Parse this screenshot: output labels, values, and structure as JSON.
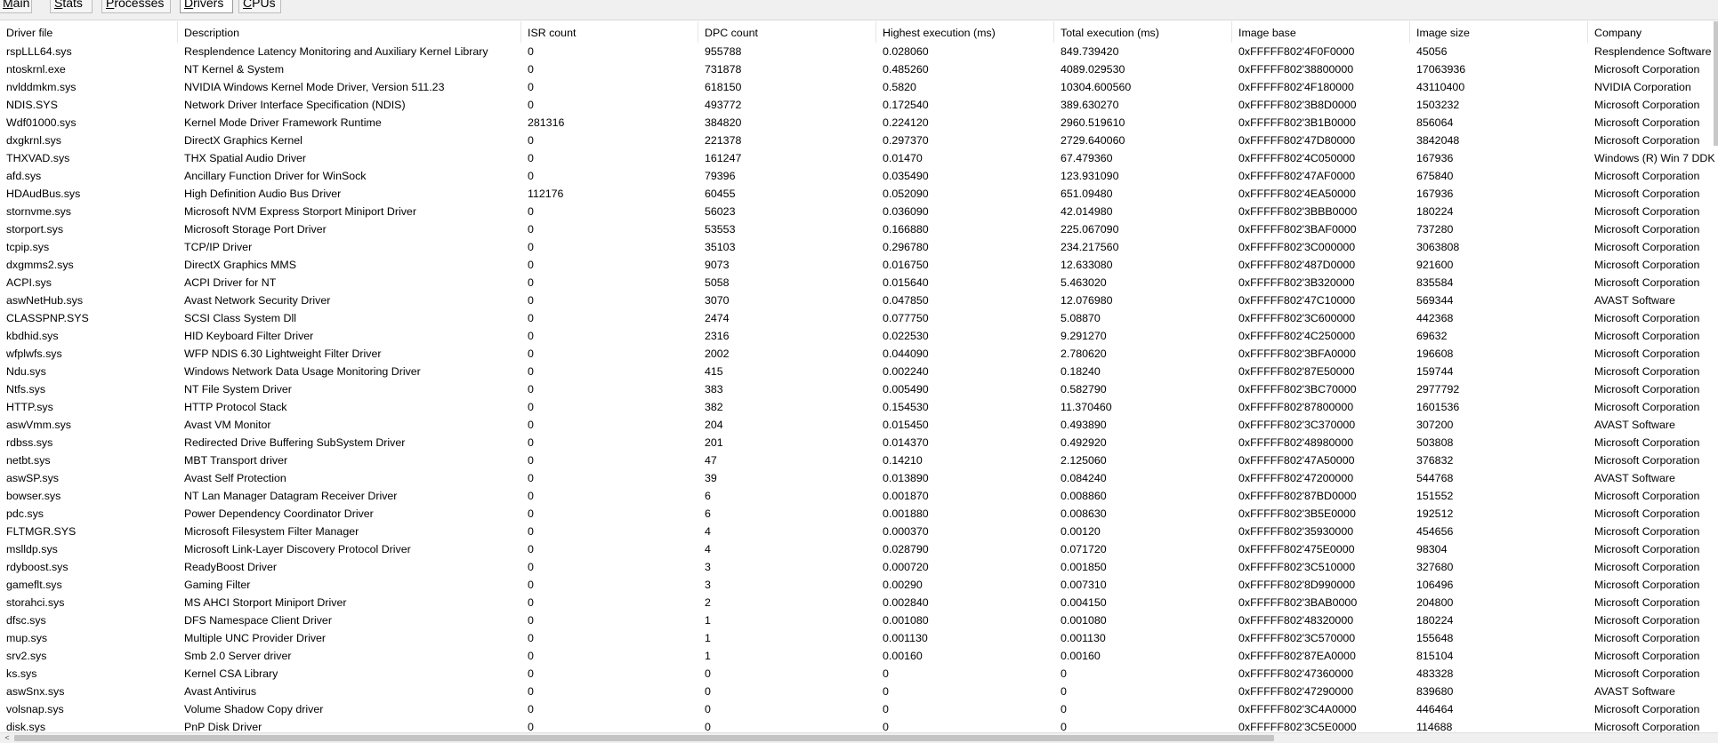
{
  "tabs": [
    {
      "label": "Main"
    },
    {
      "label": "Stats"
    },
    {
      "label": "Processes"
    },
    {
      "label": "Drivers"
    },
    {
      "label": "CPUs"
    }
  ],
  "columns": [
    "Driver file",
    "Description",
    "ISR count",
    "DPC count",
    "Highest execution (ms)",
    "Total execution (ms)",
    "Image base",
    "Image size",
    "Company"
  ],
  "rows": [
    [
      "rspLLL64.sys",
      "Resplendence Latency Monitoring and Auxiliary Kernel Library",
      "0",
      "955788",
      "0.028060",
      "849.739420",
      "0xFFFFF802'4F0F0000",
      "45056",
      "Resplendence Software"
    ],
    [
      "ntoskrnl.exe",
      "NT Kernel & System",
      "0",
      "731878",
      "0.485260",
      "4089.029530",
      "0xFFFFF802'38800000",
      "17063936",
      "Microsoft Corporation"
    ],
    [
      "nvlddmkm.sys",
      "NVIDIA Windows Kernel Mode Driver, Version 511.23",
      "0",
      "618150",
      "0.5820",
      "10304.600560",
      "0xFFFFF802'4F180000",
      "43110400",
      "NVIDIA Corporation"
    ],
    [
      "NDIS.SYS",
      "Network Driver Interface Specification (NDIS)",
      "0",
      "493772",
      "0.172540",
      "389.630270",
      "0xFFFFF802'3B8D0000",
      "1503232",
      "Microsoft Corporation"
    ],
    [
      "Wdf01000.sys",
      "Kernel Mode Driver Framework Runtime",
      "281316",
      "384820",
      "0.224120",
      "2960.519610",
      "0xFFFFF802'3B1B0000",
      "856064",
      "Microsoft Corporation"
    ],
    [
      "dxgkrnl.sys",
      "DirectX Graphics Kernel",
      "0",
      "221378",
      "0.297370",
      "2729.640060",
      "0xFFFFF802'47D80000",
      "3842048",
      "Microsoft Corporation"
    ],
    [
      "THXVAD.sys",
      "THX Spatial Audio Driver",
      "0",
      "161247",
      "0.01470",
      "67.479360",
      "0xFFFFF802'4C050000",
      "167936",
      "Windows (R) Win 7 DDK"
    ],
    [
      "afd.sys",
      "Ancillary Function Driver for WinSock",
      "0",
      "79396",
      "0.035490",
      "123.931090",
      "0xFFFFF802'47AF0000",
      "675840",
      "Microsoft Corporation"
    ],
    [
      "HDAudBus.sys",
      "High Definition Audio Bus Driver",
      "112176",
      "60455",
      "0.052090",
      "651.09480",
      "0xFFFFF802'4EA50000",
      "167936",
      "Microsoft Corporation"
    ],
    [
      "stornvme.sys",
      "Microsoft NVM Express Storport Miniport Driver",
      "0",
      "56023",
      "0.036090",
      "42.014980",
      "0xFFFFF802'3BBB0000",
      "180224",
      "Microsoft Corporation"
    ],
    [
      "storport.sys",
      "Microsoft Storage Port Driver",
      "0",
      "53553",
      "0.166880",
      "225.067090",
      "0xFFFFF802'3BAF0000",
      "737280",
      "Microsoft Corporation"
    ],
    [
      "tcpip.sys",
      "TCP/IP Driver",
      "0",
      "35103",
      "0.296780",
      "234.217560",
      "0xFFFFF802'3C000000",
      "3063808",
      "Microsoft Corporation"
    ],
    [
      "dxgmms2.sys",
      "DirectX Graphics MMS",
      "0",
      "9073",
      "0.016750",
      "12.633080",
      "0xFFFFF802'487D0000",
      "921600",
      "Microsoft Corporation"
    ],
    [
      "ACPI.sys",
      "ACPI Driver for NT",
      "0",
      "5058",
      "0.015640",
      "5.463020",
      "0xFFFFF802'3B320000",
      "835584",
      "Microsoft Corporation"
    ],
    [
      "aswNetHub.sys",
      "Avast Network Security Driver",
      "0",
      "3070",
      "0.047850",
      "12.076980",
      "0xFFFFF802'47C10000",
      "569344",
      "AVAST Software"
    ],
    [
      "CLASSPNP.SYS",
      "SCSI Class System Dll",
      "0",
      "2474",
      "0.077750",
      "5.08870",
      "0xFFFFF802'3C600000",
      "442368",
      "Microsoft Corporation"
    ],
    [
      "kbdhid.sys",
      "HID Keyboard Filter Driver",
      "0",
      "2316",
      "0.022530",
      "9.291270",
      "0xFFFFF802'4C250000",
      "69632",
      "Microsoft Corporation"
    ],
    [
      "wfplwfs.sys",
      "WFP NDIS 6.30 Lightweight Filter Driver",
      "0",
      "2002",
      "0.044090",
      "2.780620",
      "0xFFFFF802'3BFA0000",
      "196608",
      "Microsoft Corporation"
    ],
    [
      "Ndu.sys",
      "Windows Network Data Usage Monitoring Driver",
      "0",
      "415",
      "0.002240",
      "0.18240",
      "0xFFFFF802'87E50000",
      "159744",
      "Microsoft Corporation"
    ],
    [
      "Ntfs.sys",
      "NT File System Driver",
      "0",
      "383",
      "0.005490",
      "0.582790",
      "0xFFFFF802'3BC70000",
      "2977792",
      "Microsoft Corporation"
    ],
    [
      "HTTP.sys",
      "HTTP Protocol Stack",
      "0",
      "382",
      "0.154530",
      "11.370460",
      "0xFFFFF802'87800000",
      "1601536",
      "Microsoft Corporation"
    ],
    [
      "aswVmm.sys",
      "Avast VM Monitor",
      "0",
      "204",
      "0.015450",
      "0.493890",
      "0xFFFFF802'3C370000",
      "307200",
      "AVAST Software"
    ],
    [
      "rdbss.sys",
      "Redirected Drive Buffering SubSystem Driver",
      "0",
      "201",
      "0.014370",
      "0.492920",
      "0xFFFFF802'48980000",
      "503808",
      "Microsoft Corporation"
    ],
    [
      "netbt.sys",
      "MBT Transport driver",
      "0",
      "47",
      "0.14210",
      "2.125060",
      "0xFFFFF802'47A50000",
      "376832",
      "Microsoft Corporation"
    ],
    [
      "aswSP.sys",
      "Avast Self Protection",
      "0",
      "39",
      "0.013890",
      "0.084240",
      "0xFFFFF802'47200000",
      "544768",
      "AVAST Software"
    ],
    [
      "bowser.sys",
      "NT Lan Manager Datagram Receiver Driver",
      "0",
      "6",
      "0.001870",
      "0.008860",
      "0xFFFFF802'87BD0000",
      "151552",
      "Microsoft Corporation"
    ],
    [
      "pdc.sys",
      "Power Dependency Coordinator Driver",
      "0",
      "6",
      "0.001880",
      "0.008630",
      "0xFFFFF802'3B5E0000",
      "192512",
      "Microsoft Corporation"
    ],
    [
      "FLTMGR.SYS",
      "Microsoft Filesystem Filter Manager",
      "0",
      "4",
      "0.000370",
      "0.00120",
      "0xFFFFF802'35930000",
      "454656",
      "Microsoft Corporation"
    ],
    [
      "mslldp.sys",
      "Microsoft Link-Layer Discovery Protocol Driver",
      "0",
      "4",
      "0.028790",
      "0.071720",
      "0xFFFFF802'475E0000",
      "98304",
      "Microsoft Corporation"
    ],
    [
      "rdyboost.sys",
      "ReadyBoost Driver",
      "0",
      "3",
      "0.000720",
      "0.001850",
      "0xFFFFF802'3C510000",
      "327680",
      "Microsoft Corporation"
    ],
    [
      "gameflt.sys",
      "Gaming Filter",
      "0",
      "3",
      "0.00290",
      "0.007310",
      "0xFFFFF802'8D990000",
      "106496",
      "Microsoft Corporation"
    ],
    [
      "storahci.sys",
      "MS AHCI Storport Miniport Driver",
      "0",
      "2",
      "0.002840",
      "0.004150",
      "0xFFFFF802'3BAB0000",
      "204800",
      "Microsoft Corporation"
    ],
    [
      "dfsc.sys",
      "DFS Namespace Client Driver",
      "0",
      "1",
      "0.001080",
      "0.001080",
      "0xFFFFF802'48320000",
      "180224",
      "Microsoft Corporation"
    ],
    [
      "mup.sys",
      "Multiple UNC Provider Driver",
      "0",
      "1",
      "0.001130",
      "0.001130",
      "0xFFFFF802'3C570000",
      "155648",
      "Microsoft Corporation"
    ],
    [
      "srv2.sys",
      "Smb 2.0 Server driver",
      "0",
      "1",
      "0.00160",
      "0.00160",
      "0xFFFFF802'87EA0000",
      "815104",
      "Microsoft Corporation"
    ],
    [
      "ks.sys",
      "Kernel CSA Library",
      "0",
      "0",
      "0",
      "0",
      "0xFFFFF802'47360000",
      "483328",
      "Microsoft Corporation"
    ],
    [
      "aswSnx.sys",
      "Avast Antivirus",
      "0",
      "0",
      "0",
      "0",
      "0xFFFFF802'47290000",
      "839680",
      "AVAST Software"
    ],
    [
      "volsnap.sys",
      "Volume Shadow Copy driver",
      "0",
      "0",
      "0",
      "0",
      "0xFFFFF802'3C4A0000",
      "446464",
      "Microsoft Corporation"
    ],
    [
      "disk.sys",
      "PnP Disk Driver",
      "0",
      "0",
      "0",
      "0",
      "0xFFFFF802'3C5E0000",
      "114688",
      "Microsoft Corporation"
    ]
  ],
  "scrollbar": {
    "left_arrow": "<"
  }
}
